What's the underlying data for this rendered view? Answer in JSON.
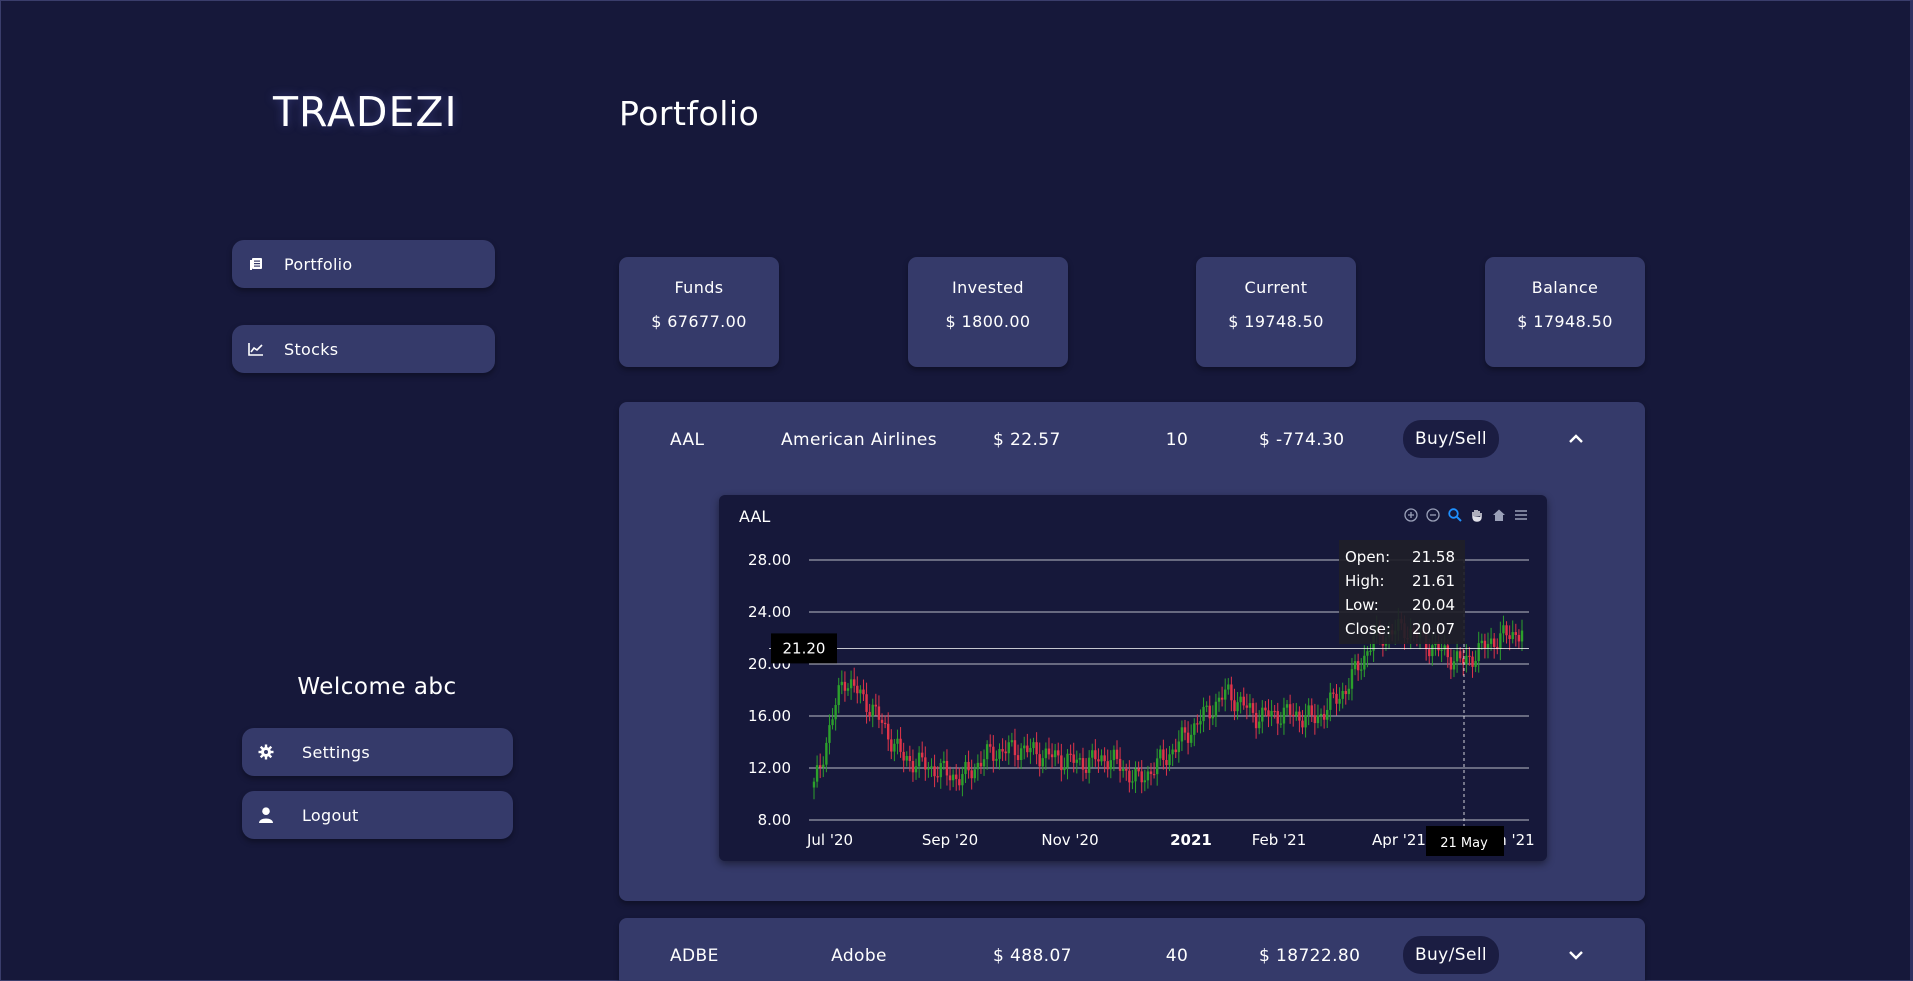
{
  "app": {
    "logo": "TRADEZI"
  },
  "sidebar": {
    "items": [
      {
        "label": "Portfolio",
        "icon": "list-icon"
      },
      {
        "label": "Stocks",
        "icon": "chart-line-icon"
      }
    ],
    "welcome": "Welcome abc",
    "settings_label": "Settings",
    "logout_label": "Logout"
  },
  "main": {
    "title": "Portfolio",
    "stats": [
      {
        "label": "Funds",
        "value": "$ 67677.00"
      },
      {
        "label": "Invested",
        "value": "$ 1800.00"
      },
      {
        "label": "Current",
        "value": "$ 19748.50"
      },
      {
        "label": "Balance",
        "value": "$ 17948.50"
      }
    ],
    "stocks": [
      {
        "symbol": "AAL",
        "name": "American Airlines",
        "price": "$ 22.57",
        "qty": "10",
        "pl": "$ -774.30",
        "action": "Buy/Sell",
        "expanded": true
      },
      {
        "symbol": "ADBE",
        "name": "Adobe",
        "price": "$ 488.07",
        "qty": "40",
        "pl": "$ 18722.80",
        "action": "Buy/Sell",
        "expanded": false
      }
    ]
  },
  "chart_data": {
    "type": "candlestick",
    "title": "AAL",
    "y_ticks": [
      "28.00",
      "24.00",
      "20.00",
      "16.00",
      "12.00",
      "8.00"
    ],
    "ylim": [
      8,
      28
    ],
    "x_ticks": [
      "Jul '20",
      "Sep '20",
      "Nov '20",
      "2021",
      "Feb '21",
      "Apr '21",
      "Jun '21"
    ],
    "grid": true,
    "crosshair": {
      "y_label": "21.20",
      "x_label": "21 May"
    },
    "tooltip": {
      "Open": "21.58",
      "High": "21.61",
      "Low": "20.04",
      "Close": "20.07"
    },
    "series": [
      {
        "x": "Jun '20",
        "close": 10.5
      },
      {
        "x": "Jul '20",
        "close": 19.0
      },
      {
        "x": "Jul '20",
        "close": 16.5
      },
      {
        "x": "Aug '20",
        "close": 12.8
      },
      {
        "x": "Aug '20",
        "close": 12.0
      },
      {
        "x": "Sep '20",
        "close": 11.2
      },
      {
        "x": "Sep '20",
        "close": 13.2
      },
      {
        "x": "Oct '20",
        "close": 13.5
      },
      {
        "x": "Oct '20",
        "close": 12.9
      },
      {
        "x": "Nov '20",
        "close": 12.4
      },
      {
        "x": "Nov '20",
        "close": 12.8
      },
      {
        "x": "Dec '20",
        "close": 11.0
      },
      {
        "x": "Dec '20",
        "close": 13.0
      },
      {
        "x": "Jan '21",
        "close": 15.5
      },
      {
        "x": "Jan '21",
        "close": 17.8
      },
      {
        "x": "Feb '21",
        "close": 16.0
      },
      {
        "x": "Feb '21",
        "close": 16.2
      },
      {
        "x": "Mar '21",
        "close": 15.8
      },
      {
        "x": "Mar '21",
        "close": 18.0
      },
      {
        "x": "Apr '21",
        "close": 22.0
      },
      {
        "x": "Apr '21",
        "close": 22.8
      },
      {
        "x": "May '21",
        "close": 21.3
      },
      {
        "x": "May '21",
        "close": 20.07
      },
      {
        "x": "Jun '21",
        "close": 21.8
      },
      {
        "x": "Jun '21",
        "close": 22.57
      }
    ],
    "colors": {
      "up": "#2ca02c",
      "down": "#e0344a",
      "grid": "#d8d8e0",
      "crosshair": "#ffffff"
    }
  }
}
